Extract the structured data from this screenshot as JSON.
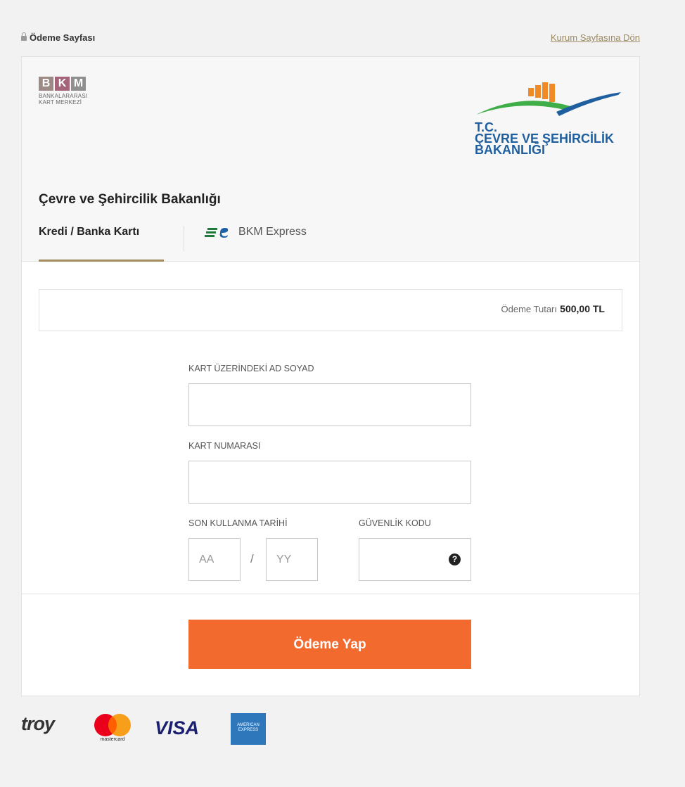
{
  "topbar": {
    "secure_label": "Ödeme Sayfası",
    "back_link": "Kurum Sayfasına Dön"
  },
  "header": {
    "bkm_logo": {
      "letters": [
        "B",
        "K",
        "M"
      ],
      "colors": [
        "#9c8a86",
        "#a4657a",
        "#8f8f8f"
      ],
      "line1": "BANKALARARASI",
      "line2": "KART MERKEZİ"
    },
    "ministry_logo": {
      "line1": "T.C.",
      "line2": "ÇEVRE VE ŞEHİRCİLİK",
      "line3": "BAKANLIĞI",
      "colors": {
        "orange": "#f08a24",
        "green": "#3fae49",
        "blue": "#1f5f9f"
      }
    },
    "institution_name": "Çevre ve Şehircilik Bakanlığı"
  },
  "tabs": [
    {
      "label": "Kredi / Banka Kartı",
      "active": true
    },
    {
      "label": "BKM Express",
      "icon": "bkm-express-icon",
      "active": false
    }
  ],
  "amount": {
    "label": "Ödeme Tutarı",
    "value": "500,00 TL"
  },
  "form": {
    "name_label": "KART ÜZERİNDEKİ AD SOYAD",
    "name_value": "",
    "card_label": "KART NUMARASI",
    "card_value": "",
    "expiry_label": "SON KULLANMA TARİHİ",
    "month_placeholder": "AA",
    "year_placeholder": "YY",
    "slash": "/",
    "cvv_label": "GÜVENLİK KODU",
    "cvv_value": "",
    "help": "?"
  },
  "pay_button": {
    "label": "Ödeme Yap",
    "color": "#f26a2e"
  },
  "card_brands": {
    "troy": "troy",
    "mastercard": "mastercard",
    "visa": "VISA",
    "amex_line1": "AMERICAN",
    "amex_line2": "EXPRESS"
  }
}
